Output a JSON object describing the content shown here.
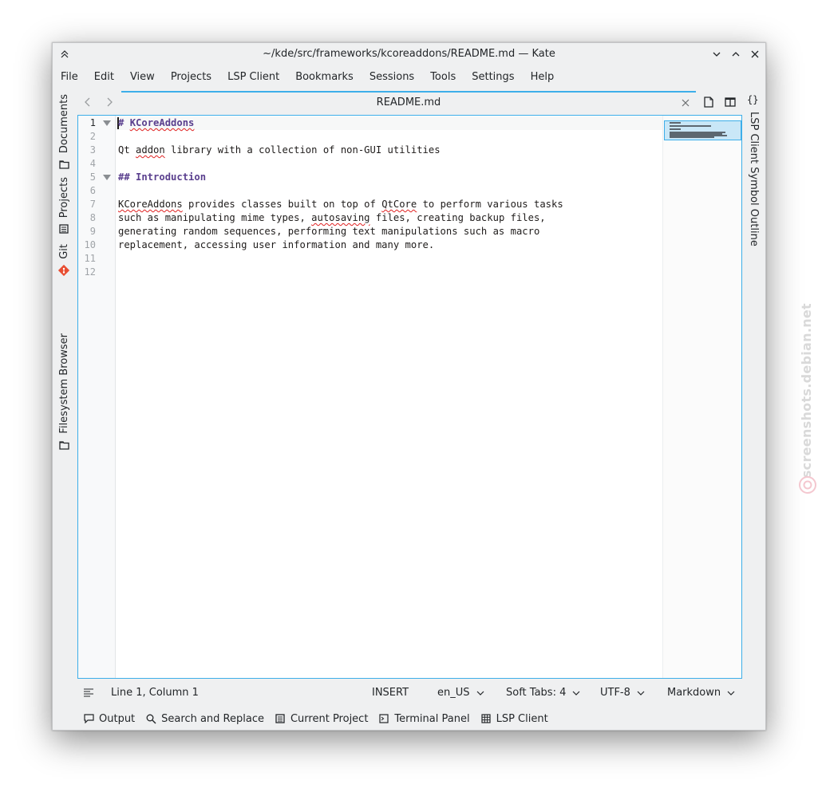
{
  "window": {
    "title": "~/kde/src/frameworks/kcoreaddons/README.md — Kate"
  },
  "menubar": [
    "File",
    "Edit",
    "View",
    "Projects",
    "LSP Client",
    "Bookmarks",
    "Sessions",
    "Tools",
    "Settings",
    "Help"
  ],
  "left_sidebar": {
    "documents": "Documents",
    "projects": "Projects",
    "git": "Git",
    "filesystem": "Filesystem Browser"
  },
  "right_sidebar": {
    "symbol_outline": "LSP Client Symbol Outline"
  },
  "tab": {
    "label": "README.md"
  },
  "editor": {
    "line_numbers": [
      "1",
      "2",
      "3",
      "4",
      "5",
      "6",
      "7",
      "8",
      "9",
      "10",
      "11",
      "12"
    ],
    "line1_hash": "# ",
    "line1_heading": "KCoreAddons",
    "line3_a": "Qt ",
    "line3_b": "addon",
    "line3_c": " library with a collection of non-GUI utilities",
    "line5_heading": "## Introduction",
    "line7_a": "KCoreAddons",
    "line7_b": " provides classes built on top of ",
    "line7_c": "QtCore",
    "line7_d": " to perform various tasks",
    "line8_a": "such as manipulating mime types, ",
    "line8_b": "autosaving",
    "line8_c": " files, creating backup files,",
    "line9": "generating random sequences, performing text manipulations such as macro",
    "line10": "replacement, accessing user information and many more."
  },
  "statusbar": {
    "position": "Line 1, Column 1",
    "mode": "INSERT",
    "language": "en_US",
    "indent": "Soft Tabs: 4",
    "encoding": "UTF-8",
    "syntax": "Markdown"
  },
  "toolviews": {
    "output": "Output",
    "search": "Search and Replace",
    "project": "Current Project",
    "terminal": "Terminal Panel",
    "lsp": "LSP Client"
  },
  "watermark": {
    "text": "screenshots.debian.net"
  },
  "colors": {
    "accent": "#3daee9",
    "heading": "#5a3f8e",
    "spell_error": "#e02020",
    "git_icon": "#e84d31"
  }
}
